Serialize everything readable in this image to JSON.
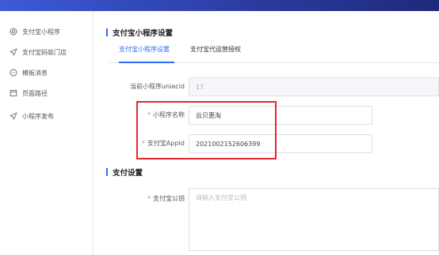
{
  "sidebar": {
    "items": [
      {
        "label": "支付宝小程序",
        "icon": "target-icon"
      },
      {
        "label": "支付宝蚂蚁门店",
        "icon": "send-icon"
      },
      {
        "label": "模板消息",
        "icon": "message-icon"
      },
      {
        "label": "页面路径",
        "icon": "page-icon"
      },
      {
        "label": "小程序发布",
        "icon": "send-icon"
      }
    ]
  },
  "main": {
    "title": "支付宝小程序设置",
    "tabs": [
      {
        "label": "支付宝小程序设置",
        "active": true
      },
      {
        "label": "支付宝代运营授权",
        "active": false
      }
    ],
    "form": {
      "uniacid_label": "当前小程序uniacid",
      "uniacid_value": "17",
      "name_label": "小程序名称",
      "name_value": "云贝惠淘",
      "appid_label": "支付宝AppId",
      "appid_value": "2021002152606399"
    },
    "pay_title": "支付设置",
    "pay_form": {
      "pubkey_label": "支付宝公钥",
      "pubkey_placeholder": "请输入支付宝公钥"
    }
  },
  "colors": {
    "accent": "#2d6cf5",
    "highlight": "#e3262e",
    "required": "#f56c6c"
  }
}
